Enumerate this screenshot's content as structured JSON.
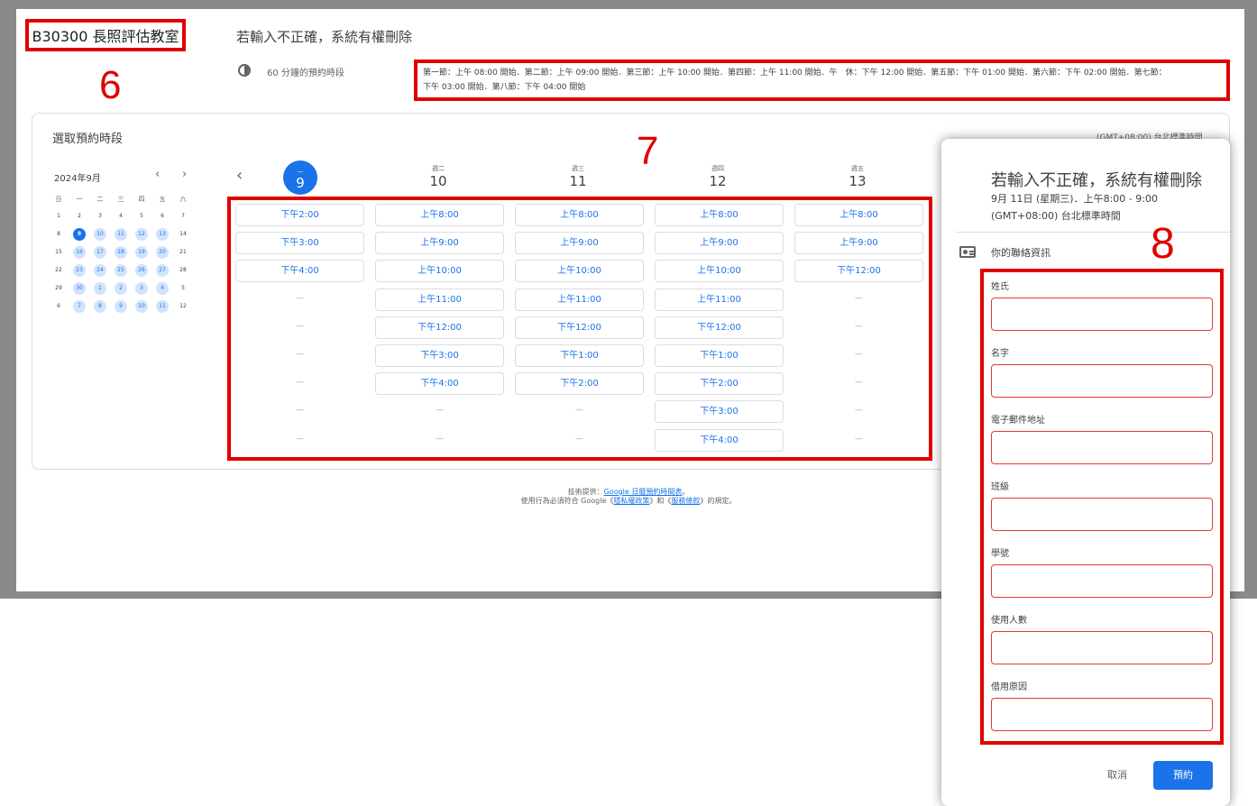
{
  "page": {
    "title": "B30300 長照評估教室",
    "header_title": "若輸入不正確，系統有權刪除",
    "duration_text": "60 分鐘的預約時段",
    "schedule_line1": "第一節：上午 08:00 開始．第二節：上午 09:00 開始．第三節：上午 10:00 開始．第四節：上午 11:00 開始．午　休：下午 12:00 開始．第五節：下午 01:00 開始．第六節：下午 02:00 開始．第七節：",
    "schedule_line2": "下午 03:00 開始．第八節：下午 04:00 開始",
    "card_title": "選取預約時段",
    "timezone": "(GMT+08:00) 台北標準時間"
  },
  "annotations": {
    "six": "6",
    "seven": "7",
    "eight": "8"
  },
  "mini_calendar": {
    "month": "2024年9月",
    "prev": "‹",
    "next": "›",
    "weekdays": [
      "日",
      "一",
      "二",
      "三",
      "四",
      "五",
      "六"
    ],
    "weeks": [
      [
        "1",
        "2",
        "3",
        "4",
        "5",
        "6",
        "7"
      ],
      [
        "8",
        "9",
        "10",
        "11",
        "12",
        "13",
        "14"
      ],
      [
        "15",
        "16",
        "17",
        "18",
        "19",
        "20",
        "21"
      ],
      [
        "22",
        "23",
        "24",
        "25",
        "26",
        "27",
        "28"
      ],
      [
        "29",
        "30",
        "1",
        "2",
        "3",
        "4",
        "5"
      ],
      [
        "6",
        "7",
        "8",
        "9",
        "10",
        "11",
        "12"
      ]
    ]
  },
  "week": {
    "prev": "‹",
    "days": [
      {
        "dow": "一",
        "num": "9"
      },
      {
        "dow": "週二",
        "num": "10"
      },
      {
        "dow": "週三",
        "num": "11"
      },
      {
        "dow": "週四",
        "num": "12"
      },
      {
        "dow": "週五",
        "num": "13"
      }
    ],
    "slots": [
      [
        "下午2:00",
        "下午3:00",
        "下午4:00",
        "—",
        "—",
        "—",
        "—",
        "—",
        "—"
      ],
      [
        "上午8:00",
        "上午9:00",
        "上午10:00",
        "上午11:00",
        "下午12:00",
        "下午3:00",
        "下午4:00",
        "—",
        "—"
      ],
      [
        "上午8:00",
        "上午9:00",
        "上午10:00",
        "上午11:00",
        "下午12:00",
        "下午1:00",
        "下午2:00",
        "—",
        "—"
      ],
      [
        "上午8:00",
        "上午9:00",
        "上午10:00",
        "上午11:00",
        "下午12:00",
        "下午1:00",
        "下午2:00",
        "下午3:00",
        "下午4:00"
      ],
      [
        "上午8:00",
        "上午9:00",
        "下午12:00",
        "—",
        "—",
        "—",
        "—",
        "—",
        "—"
      ]
    ]
  },
  "footer": {
    "line1_prefix": "技術提供：",
    "line1_link": "Google 日曆預約時間表",
    "line1_suffix": "。",
    "line2_prefix": "使用行為必須符合 Google《",
    "privacy_link": "隱私權政策",
    "line2_mid": "》和《",
    "terms_link": "服務條款",
    "line2_suffix": "》的規定。"
  },
  "dialog": {
    "title": "若輸入不正確，系統有權刪除",
    "date": "9月 11日 (星期三)．上午8:00 - 9:00",
    "timezone": "(GMT+08:00) 台北標準時間",
    "contact_label": "你的聯絡資訊",
    "fields": [
      "姓氏",
      "名字",
      "電子郵件地址",
      "班級",
      "學號",
      "使用人數",
      "借用原因"
    ],
    "cancel": "取消",
    "book": "預約"
  }
}
